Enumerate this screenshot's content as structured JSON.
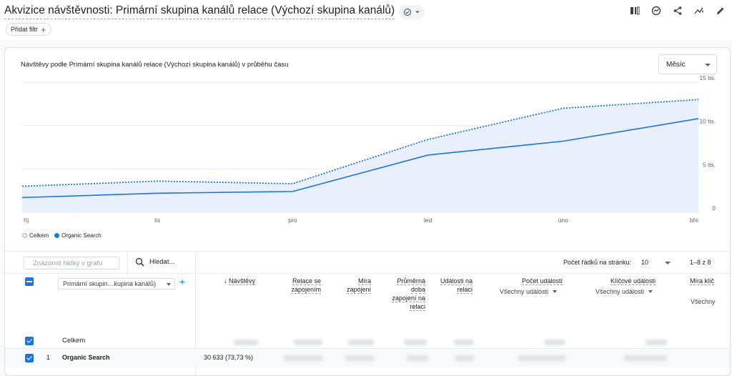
{
  "header": {
    "title": "Akvizice návštěvnosti: Primární skupina kanálů relace (Výchozí skupina kanálů)",
    "filter_label": "Přidat filtr"
  },
  "chart": {
    "title": "Návštěvy podle Primární skupina kanálů relace (Výchozí skupina kanálů) v průběhu času",
    "period": "Měsíc",
    "legend": [
      "Celkem",
      "Organic Search"
    ]
  },
  "chart_data": {
    "type": "line",
    "x": [
      "říj",
      "lis",
      "pro",
      "led",
      "úno",
      "bře"
    ],
    "ylim": [
      0,
      15000
    ],
    "y_ticks": [
      "15 tis.",
      "10 tis.",
      "5 tis.",
      "0"
    ],
    "series": [
      {
        "name": "Celkem",
        "values": [
          3000,
          3600,
          3300,
          8400,
          12000,
          13000
        ],
        "style": "dotted",
        "color": "#1a73e8"
      },
      {
        "name": "Organic Search",
        "values": [
          1700,
          2200,
          2400,
          6600,
          8200,
          10800
        ],
        "style": "solid",
        "color": "#1a73e8"
      }
    ],
    "area_fill": "#e8f0fe"
  },
  "table": {
    "plot_rows_placeholder": "Znázornit řádky v grafu",
    "search_placeholder": "Hledat...",
    "rows_per_page_label": "Počet řádků na stránku:",
    "rows_per_page": "10",
    "range": "1–8 z 8",
    "dimension": "Primární skupin…kupina kanálů)",
    "columns": [
      {
        "label": "Návštěvy"
      },
      {
        "label": "Relace se zapojením"
      },
      {
        "label": "Míra zapojení"
      },
      {
        "label": "Průměrná doba zapojení na relaci"
      },
      {
        "label": "Události na relaci"
      },
      {
        "label": "Počet událostí",
        "sub": "Všechny události"
      },
      {
        "label": "Klíčové události",
        "sub": "Všechny události"
      },
      {
        "label": "Míra klíč",
        "sub": "Všechny"
      }
    ],
    "total_label": "Celkem",
    "rows": [
      {
        "index": "1",
        "label": "Organic Search",
        "visits": "30 633 (73,73 %)"
      }
    ]
  }
}
